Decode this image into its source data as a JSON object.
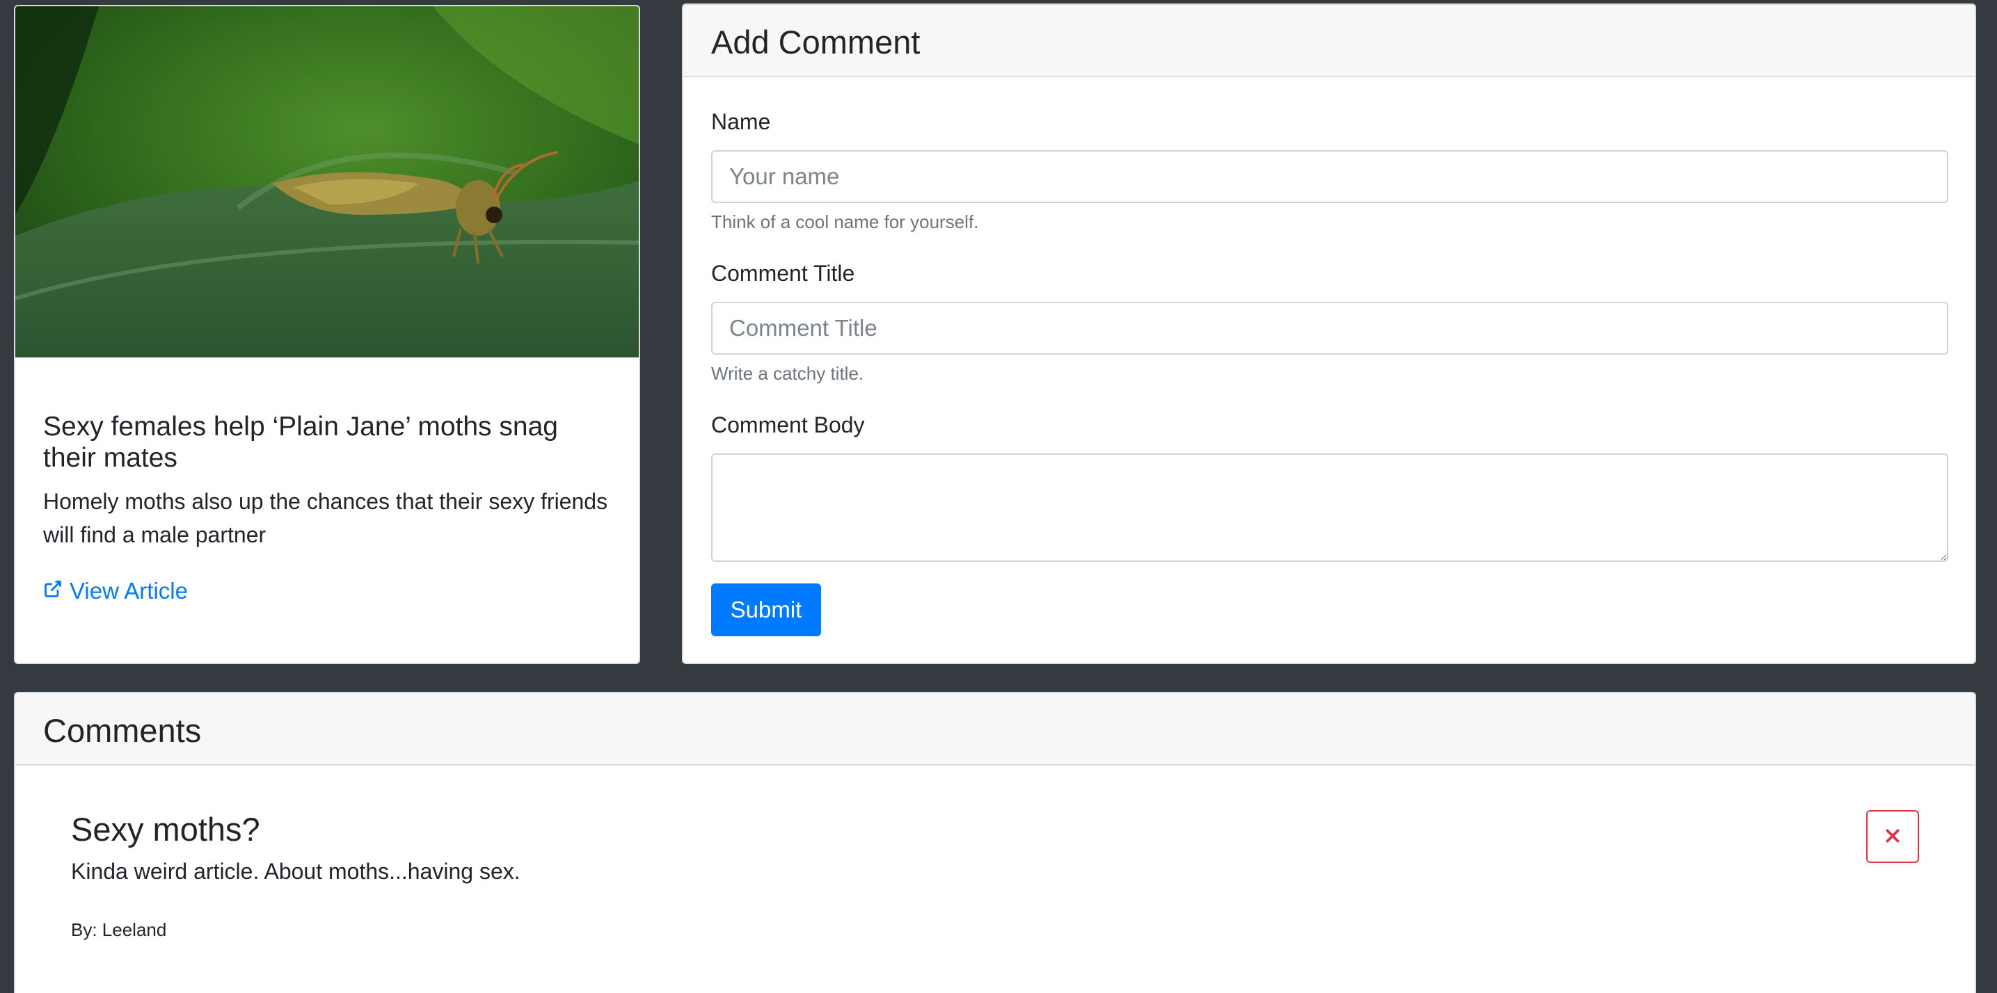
{
  "article": {
    "title": "Sexy females help ‘Plain Jane’ moths snag their mates",
    "summary": "Homely moths also up the chances that their sexy friends will find a male partner",
    "link_label": "View Article",
    "link_icon": "external-link-icon",
    "image_subject": "moth on green leaf"
  },
  "add_comment": {
    "header": "Add Comment",
    "name_label": "Name",
    "name_placeholder": "Your name",
    "name_help": "Think of a cool name for yourself.",
    "title_label": "Comment Title",
    "title_placeholder": "Comment Title",
    "title_help": "Write a catchy title.",
    "body_label": "Comment Body",
    "submit_label": "Submit"
  },
  "comments": {
    "header": "Comments",
    "items": [
      {
        "title": "Sexy moths?",
        "body": "Kinda weird article. About moths...having sex.",
        "author_prefix": "By: ",
        "author": "Leeland"
      }
    ]
  },
  "colors": {
    "background": "#343a40",
    "primary": "#007bff",
    "danger": "#dc3545",
    "header_bg": "#f7f7f7"
  }
}
